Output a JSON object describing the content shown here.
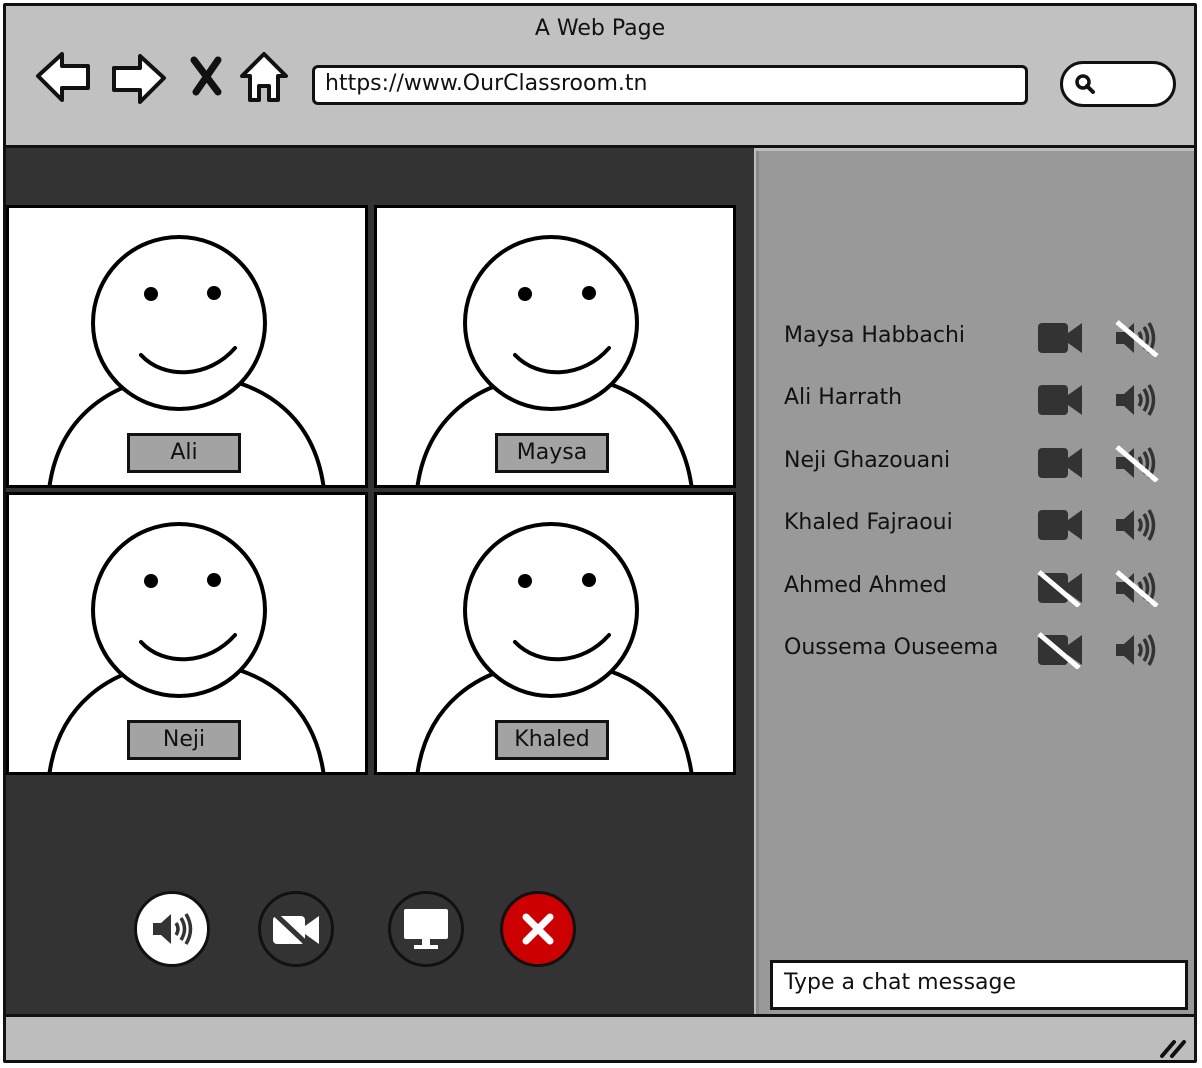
{
  "browser": {
    "title": "A Web Page",
    "url": "https://www.OurClassroom.tn",
    "nav_icons": [
      "back-arrow-icon",
      "forward-arrow-icon",
      "close-x-icon",
      "home-icon"
    ],
    "search_icon": "search-icon"
  },
  "videos": [
    {
      "name": "Ali"
    },
    {
      "name": "Maysa"
    },
    {
      "name": "Neji"
    },
    {
      "name": "Khaled"
    }
  ],
  "controls": [
    {
      "icon": "speaker-icon",
      "state": "on",
      "bg": "#ffffff"
    },
    {
      "icon": "camera-off-icon",
      "state": "off",
      "bg": "#333333"
    },
    {
      "icon": "screen-share-icon",
      "state": "idle",
      "bg": "#333333"
    },
    {
      "icon": "end-call-icon",
      "state": "danger",
      "bg": "#cc0000"
    }
  ],
  "participants": [
    {
      "name": "Maysa Habbachi",
      "camera": "on",
      "audio": "muted"
    },
    {
      "name": "Ali Harrath",
      "camera": "on",
      "audio": "on"
    },
    {
      "name": "Neji Ghazouani",
      "camera": "on",
      "audio": "muted"
    },
    {
      "name": "Khaled Fajraoui",
      "camera": "on",
      "audio": "on"
    },
    {
      "name": "Ahmed Ahmed",
      "camera": "off",
      "audio": "muted"
    },
    {
      "name": "Oussema Ouseema",
      "camera": "off",
      "audio": "on"
    }
  ],
  "chat": {
    "placeholder": "Type a chat message"
  },
  "colors": {
    "dark_panel": "#333333",
    "side_panel": "#999999",
    "chrome": "#c1c1c1",
    "danger": "#cc0000",
    "icon_dark": "#333333"
  }
}
